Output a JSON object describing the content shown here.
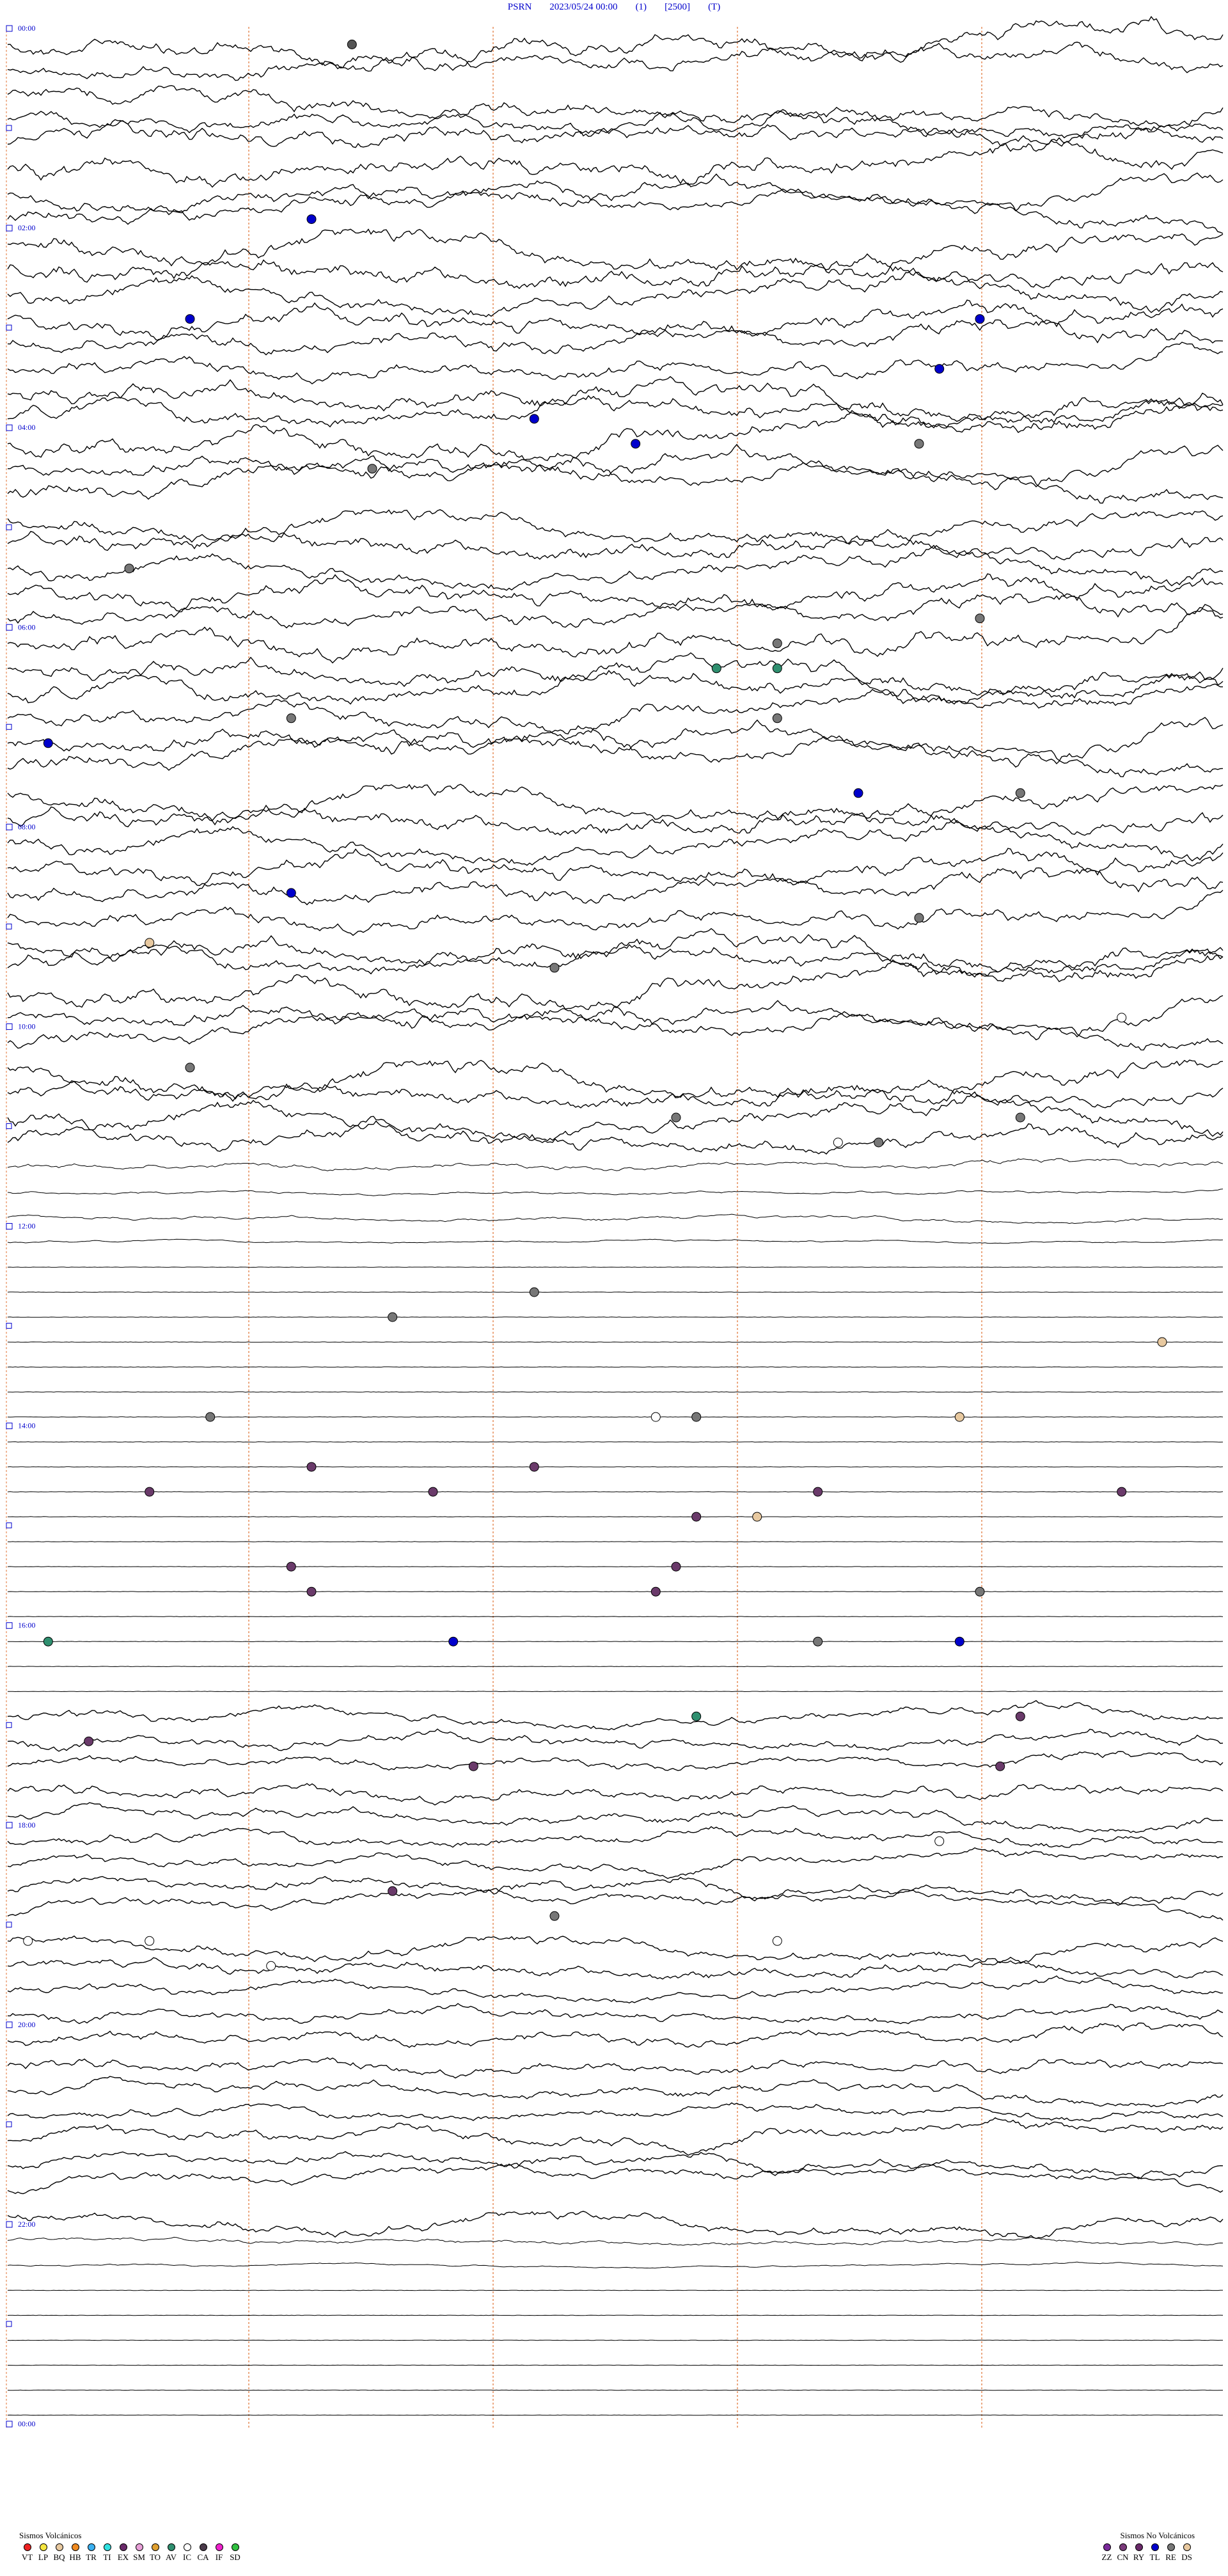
{
  "header": {
    "station": "PSRN",
    "datetime": "2023/05/24 00:00",
    "channel": "(1)",
    "scale": "[2500]",
    "mode": "(T)"
  },
  "chart_data": {
    "type": "helicorder",
    "hours_per_line_label_interval": 2,
    "time_labels": [
      "00:00",
      "02:00",
      "04:00",
      "06:00",
      "08:00",
      "10:00",
      "12:00",
      "14:00",
      "16:00",
      "18:00",
      "20:00",
      "22:00",
      "00:00"
    ],
    "rows_per_hour": 4,
    "total_rows": 96,
    "line_color": "#000000",
    "marker_line_color": "#e07030",
    "label_color": "#0000cc",
    "row_noise_level": [
      2.4,
      2.1,
      2.2,
      2.0,
      2.3,
      2.6,
      2.0,
      2.2,
      2.4,
      2.6,
      2.3,
      2.5,
      2.2,
      2.0,
      2.4,
      2.3,
      2.5,
      2.2,
      2.4,
      2.0,
      2.3,
      2.1,
      2.5,
      2.2,
      2.6,
      2.3,
      2.4,
      2.1,
      2.5,
      2.3,
      2.2,
      2.4,
      2.2,
      2.5,
      2.3,
      2.1,
      2.4,
      2.2,
      2.5,
      2.3,
      2.0,
      2.4,
      2.1,
      2.3,
      2.2,
      0.8,
      0.4,
      0.5,
      0.3,
      0.2,
      0.2,
      0.1,
      0.1,
      0.1,
      0.1,
      0.1,
      0.1,
      0.1,
      0.1,
      0.1,
      0.1,
      0.1,
      0.1,
      0.1,
      0.1,
      0.1,
      0.2,
      1.4,
      1.5,
      1.3,
      1.6,
      1.4,
      1.5,
      1.3,
      1.6,
      1.4,
      1.5,
      1.6,
      1.3,
      1.4,
      1.6,
      1.5,
      1.4,
      1.3,
      1.6,
      1.5,
      1.4,
      1.5,
      0.6,
      0.3,
      0.2,
      0.2,
      0.2,
      0.2,
      0.2,
      0.1
    ],
    "events": [
      {
        "row": 0,
        "minute": 17,
        "type": "DS",
        "color": "#555555"
      },
      {
        "row": 7,
        "minute": 15,
        "type": "TL",
        "color": "#0000cc"
      },
      {
        "row": 11,
        "minute": 9,
        "type": "TL",
        "color": "#0000cc"
      },
      {
        "row": 11,
        "minute": 48,
        "type": "TL",
        "color": "#0000cc"
      },
      {
        "row": 13,
        "minute": 46,
        "type": "TL",
        "color": "#0000cc"
      },
      {
        "row": 15,
        "minute": 26,
        "type": "TL",
        "color": "#0000cc"
      },
      {
        "row": 16,
        "minute": 31,
        "type": "TL",
        "color": "#0000cc"
      },
      {
        "row": 16,
        "minute": 45,
        "type": "DS",
        "color": "#777777"
      },
      {
        "row": 17,
        "minute": 18,
        "type": "DS",
        "color": "#777777"
      },
      {
        "row": 21,
        "minute": 6,
        "type": "DS",
        "color": "#777777"
      },
      {
        "row": 23,
        "minute": 48,
        "type": "DS",
        "color": "#777777"
      },
      {
        "row": 24,
        "minute": 38,
        "type": "DS",
        "color": "#777777"
      },
      {
        "row": 25,
        "minute": 35,
        "type": "IC",
        "color": "#2f8f6f"
      },
      {
        "row": 25,
        "minute": 38,
        "type": "IC",
        "color": "#2f8f6f"
      },
      {
        "row": 27,
        "minute": 14,
        "type": "DS",
        "color": "#777777"
      },
      {
        "row": 27,
        "minute": 38,
        "type": "DS",
        "color": "#777777"
      },
      {
        "row": 28,
        "minute": 2,
        "type": "TL",
        "color": "#0000cc"
      },
      {
        "row": 30,
        "minute": 42,
        "type": "TL",
        "color": "#0000cc"
      },
      {
        "row": 30,
        "minute": 50,
        "type": "DS",
        "color": "#777777"
      },
      {
        "row": 34,
        "minute": 14,
        "type": "TL",
        "color": "#0000cc"
      },
      {
        "row": 35,
        "minute": 45,
        "type": "DS",
        "color": "#777777"
      },
      {
        "row": 36,
        "minute": 7,
        "type": "BQ",
        "color": "#e8c9a0"
      },
      {
        "row": 37,
        "minute": 27,
        "type": "DS",
        "color": "#777777"
      },
      {
        "row": 39,
        "minute": 55,
        "type": "IC",
        "color": "#ffffff"
      },
      {
        "row": 41,
        "minute": 9,
        "type": "DS",
        "color": "#777777"
      },
      {
        "row": 43,
        "minute": 33,
        "type": "DS",
        "color": "#777777"
      },
      {
        "row": 43,
        "minute": 50,
        "type": "DS",
        "color": "#777777"
      },
      {
        "row": 44,
        "minute": 43,
        "type": "DS",
        "color": "#777777"
      },
      {
        "row": 44,
        "minute": 41,
        "type": "IC",
        "color": "#ffffff"
      },
      {
        "row": 50,
        "minute": 26,
        "type": "DS",
        "color": "#777777"
      },
      {
        "row": 51,
        "minute": 19,
        "type": "DS",
        "color": "#777777"
      },
      {
        "row": 52,
        "minute": 57,
        "type": "BQ",
        "color": "#e8c9a0"
      },
      {
        "row": 55,
        "minute": 10,
        "type": "DS",
        "color": "#777777"
      },
      {
        "row": 55,
        "minute": 32,
        "type": "IC",
        "color": "#ffffff"
      },
      {
        "row": 55,
        "minute": 47,
        "type": "BQ",
        "color": "#e8c9a0"
      },
      {
        "row": 55,
        "minute": 34,
        "type": "DS",
        "color": "#777777"
      },
      {
        "row": 57,
        "minute": 15,
        "type": "CA",
        "color": "#6a3a6a"
      },
      {
        "row": 57,
        "minute": 26,
        "type": "CA",
        "color": "#6a3a6a"
      },
      {
        "row": 58,
        "minute": 21,
        "type": "CA",
        "color": "#6a3a6a"
      },
      {
        "row": 58,
        "minute": 7,
        "type": "CA",
        "color": "#6a3a6a"
      },
      {
        "row": 58,
        "minute": 40,
        "type": "CA",
        "color": "#6a3a6a"
      },
      {
        "row": 58,
        "minute": 55,
        "type": "CA",
        "color": "#6a3a6a"
      },
      {
        "row": 59,
        "minute": 34,
        "type": "CA",
        "color": "#6a3a6a"
      },
      {
        "row": 59,
        "minute": 37,
        "type": "BQ",
        "color": "#e8c9a0"
      },
      {
        "row": 61,
        "minute": 33,
        "type": "CA",
        "color": "#6a3a6a"
      },
      {
        "row": 61,
        "minute": 14,
        "type": "CA",
        "color": "#6a3a6a"
      },
      {
        "row": 62,
        "minute": 48,
        "type": "DS",
        "color": "#777777"
      },
      {
        "row": 62,
        "minute": 32,
        "type": "CA",
        "color": "#6a3a6a"
      },
      {
        "row": 62,
        "minute": 15,
        "type": "CA",
        "color": "#6a3a6a"
      },
      {
        "row": 64,
        "minute": 2,
        "type": "IC",
        "color": "#2f8f6f"
      },
      {
        "row": 64,
        "minute": 22,
        "type": "TL",
        "color": "#0000cc"
      },
      {
        "row": 64,
        "minute": 47,
        "type": "TL",
        "color": "#0000cc"
      },
      {
        "row": 64,
        "minute": 40,
        "type": "DS",
        "color": "#777777"
      },
      {
        "row": 67,
        "minute": 34,
        "type": "IC",
        "color": "#2f8f6f"
      },
      {
        "row": 67,
        "minute": 50,
        "type": "CA",
        "color": "#6a3a6a"
      },
      {
        "row": 68,
        "minute": 4,
        "type": "CA",
        "color": "#6a3a6a"
      },
      {
        "row": 69,
        "minute": 23,
        "type": "CA",
        "color": "#6a3a6a"
      },
      {
        "row": 69,
        "minute": 49,
        "type": "CA",
        "color": "#6a3a6a"
      },
      {
        "row": 72,
        "minute": 46,
        "type": "IC",
        "color": "#ffffff"
      },
      {
        "row": 74,
        "minute": 19,
        "type": "CA",
        "color": "#6a3a6a"
      },
      {
        "row": 75,
        "minute": 27,
        "type": "DS",
        "color": "#777777"
      },
      {
        "row": 76,
        "minute": 7,
        "type": "IC",
        "color": "#ffffff"
      },
      {
        "row": 76,
        "minute": 38,
        "type": "IC",
        "color": "#ffffff"
      },
      {
        "row": 77,
        "minute": 13,
        "type": "IC",
        "color": "#ffffff"
      },
      {
        "row": 76,
        "minute": 1,
        "type": "IC",
        "color": "#ffffff"
      }
    ]
  },
  "legend_volcanic": {
    "title": "Sismos Volcánicos",
    "items": [
      {
        "code": "VT",
        "color": "#ee2222"
      },
      {
        "code": "LP",
        "color": "#f5e640"
      },
      {
        "code": "BQ",
        "color": "#e8c9a0"
      },
      {
        "code": "HB",
        "color": "#f08a20"
      },
      {
        "code": "TR",
        "color": "#3ab0f0"
      },
      {
        "code": "TI",
        "color": "#30e0e0"
      },
      {
        "code": "EX",
        "color": "#6a2a6a"
      },
      {
        "code": "SM",
        "color": "#e8a0d8"
      },
      {
        "code": "TO",
        "color": "#e0a030"
      },
      {
        "code": "AV",
        "color": "#2f8f6f"
      },
      {
        "code": "IC",
        "color": "#ffffff"
      },
      {
        "code": "CA",
        "color": "#4a3a4a"
      },
      {
        "code": "IF",
        "color": "#ee22cc"
      },
      {
        "code": "SD",
        "color": "#30c040"
      }
    ]
  },
  "legend_nonvolcanic": {
    "title": "Sismos No Volcánicos",
    "items": [
      {
        "code": "ZZ",
        "color": "#7a2a9a"
      },
      {
        "code": "CN",
        "color": "#7a3a7a"
      },
      {
        "code": "RY",
        "color": "#6a2a6a"
      },
      {
        "code": "TL",
        "color": "#0000cc"
      },
      {
        "code": "RE",
        "color": "#777777"
      },
      {
        "code": "DS",
        "color": "#e8c9a0"
      }
    ]
  }
}
